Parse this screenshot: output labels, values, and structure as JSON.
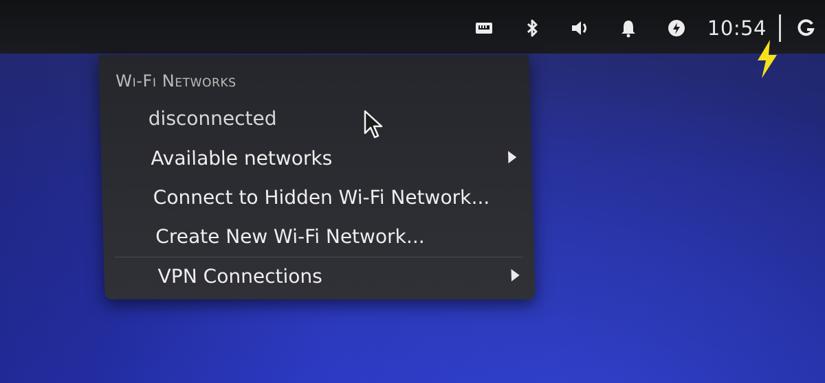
{
  "top_panel": {
    "tray": {
      "icons": [
        {
          "name": "network-wired-icon"
        },
        {
          "name": "bluetooth-icon"
        },
        {
          "name": "volume-icon"
        },
        {
          "name": "notification-bell-icon"
        },
        {
          "name": "power-status-icon"
        }
      ],
      "clock": "10:54",
      "session_icon": "session-g-icon"
    },
    "charging_icon": "charging-bolt-icon",
    "accent_colors": {
      "bolt": "#f5e21b",
      "icon": "#ececec"
    }
  },
  "wifi_menu": {
    "section_title": "Wi-Fi Networks",
    "status": "disconnected",
    "items": [
      {
        "label": "Available networks",
        "has_submenu": true
      },
      {
        "label": "Connect to Hidden Wi-Fi Network...",
        "has_submenu": false
      },
      {
        "label": "Create New Wi-Fi Network...",
        "has_submenu": false
      }
    ],
    "vpn": {
      "label": "VPN Connections",
      "has_submenu": true
    }
  }
}
